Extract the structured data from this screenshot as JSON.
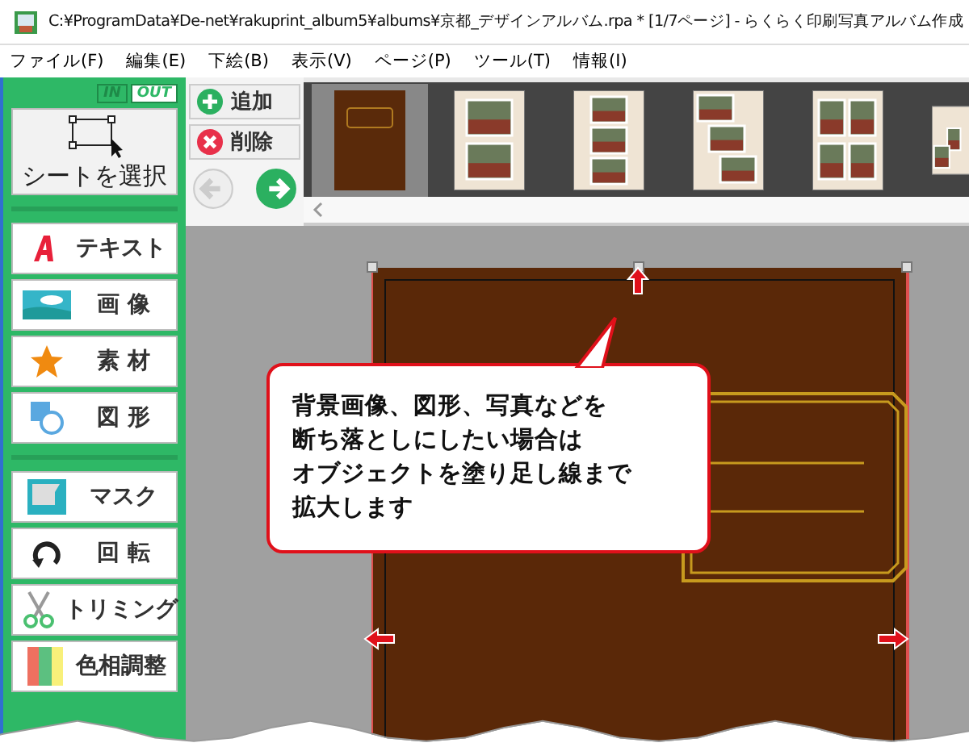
{
  "window": {
    "title": "C:¥ProgramData¥De-net¥rakuprint_album5¥albums¥京都_デザインアルバム.rpa *  [1/7ページ] - らくらく印刷写真アルバム作成"
  },
  "menu": [
    "ファイル(F)",
    "編集(E)",
    "下絵(B)",
    "表示(V)",
    "ページ(P)",
    "ツール(T)",
    "情報(I)"
  ],
  "io_toggle": [
    {
      "label": "IN",
      "selected": false
    },
    {
      "label": "OUT",
      "selected": true
    }
  ],
  "select_sheet_button": {
    "label": "シートを選択"
  },
  "tool_groups": [
    {
      "tools": [
        {
          "label": "テキスト",
          "kind": "text"
        },
        {
          "label": "画 像",
          "kind": "image"
        },
        {
          "label": "素 材",
          "kind": "material"
        },
        {
          "label": "図 形",
          "kind": "shape"
        }
      ]
    },
    {
      "tools": [
        {
          "label": "マスク",
          "kind": "mask"
        },
        {
          "label": "回 転",
          "kind": "rotate"
        },
        {
          "label": "トリミング",
          "kind": "trim"
        },
        {
          "label": "色相調整",
          "kind": "hue"
        }
      ]
    }
  ],
  "page_buttons": [
    {
      "label": "追加",
      "kind": "add"
    },
    {
      "label": "削除",
      "kind": "delete"
    }
  ],
  "nav_buttons": [
    {
      "kind": "back",
      "disabled": true
    },
    {
      "kind": "forward",
      "disabled": false
    }
  ],
  "thumbnails": [
    {
      "kind": "cover",
      "selected": true
    },
    {
      "kind": "two",
      "selected": false
    },
    {
      "kind": "three",
      "selected": false
    },
    {
      "kind": "scattered",
      "selected": false
    },
    {
      "kind": "grid",
      "selected": false
    },
    {
      "kind": "partial",
      "selected": false
    }
  ],
  "callout": {
    "lines": [
      "背景画像、図形、写真などを",
      "断ち落としにしたい場合は",
      "オブジェクトを塗り足し線まで",
      "拡大します"
    ]
  }
}
